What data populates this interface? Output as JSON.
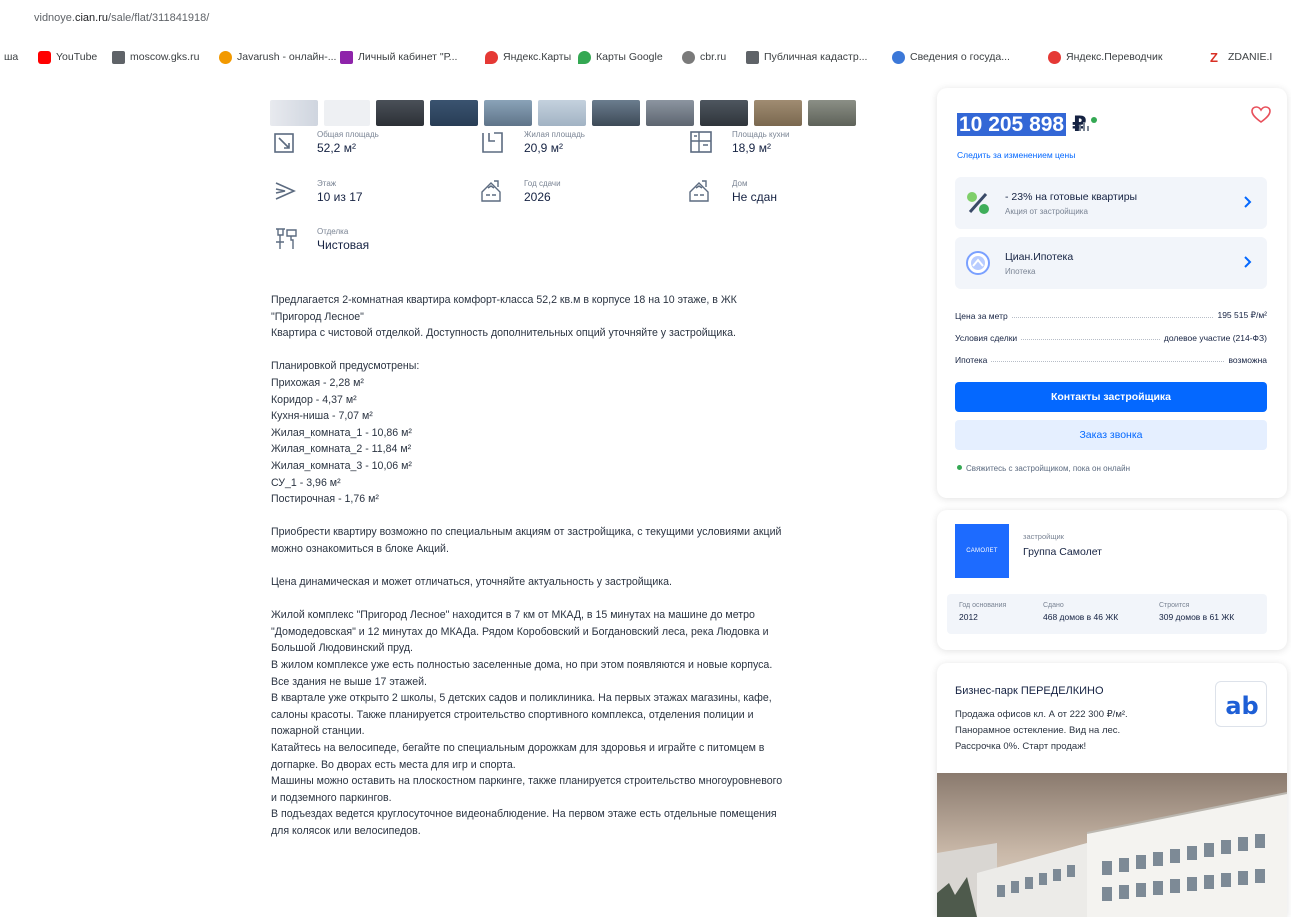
{
  "browser": {
    "url_prefix": "vidnoye.",
    "url_domain": "cian.ru",
    "url_path": "/sale/flat/311841918/",
    "bookmarks": [
      {
        "label": "ша",
        "color": "#ffffff",
        "icon": "none"
      },
      {
        "label": "YouTube",
        "color": "#ff0000",
        "icon": "youtube-icon"
      },
      {
        "label": "moscow.gks.ru",
        "color": "#5f6368",
        "icon": "doc-icon"
      },
      {
        "label": "Javarush - онлайн-...",
        "color": "#f29900",
        "icon": "javarush-icon"
      },
      {
        "label": "Личный кабинет \"Р...",
        "color": "#8e24aa",
        "icon": "person-icon"
      },
      {
        "label": "Яндекс.Карты",
        "color": "#e53935",
        "icon": "pin-icon"
      },
      {
        "label": "Карты Google",
        "color": "#34a853",
        "icon": "pin-icon"
      },
      {
        "label": "cbr.ru",
        "color": "#7a7a7a",
        "icon": "bank-icon"
      },
      {
        "label": "Публичная кадастр...",
        "color": "#5f6368",
        "icon": "doc-icon"
      },
      {
        "label": "Сведения о госуда...",
        "color": "#3c78d8",
        "icon": "globe-icon"
      },
      {
        "label": "Яндекс.Переводчик",
        "color": "#e53935",
        "icon": "translate-icon"
      },
      {
        "label": "ZDANIE.I",
        "color": "#d93025",
        "icon": "z-icon"
      }
    ]
  },
  "features": [
    {
      "label": "Общая площадь",
      "value": "52,2 м²",
      "icon": "area-icon"
    },
    {
      "label": "Жилая площадь",
      "value": "20,9 м²",
      "icon": "living-area-icon"
    },
    {
      "label": "Площадь кухни",
      "value": "18,9 м²",
      "icon": "kitchen-icon"
    },
    {
      "label": "Этаж",
      "value": "10 из 17",
      "icon": "stairs-icon"
    },
    {
      "label": "Год сдачи",
      "value": "2026",
      "icon": "building-icon"
    },
    {
      "label": "Дом",
      "value": "Не сдан",
      "icon": "building-icon"
    },
    {
      "label": "Отделка",
      "value": "Чистовая",
      "icon": "finish-icon"
    }
  ],
  "description": [
    "Предлагается 2-комнатная квартира комфорт-класса 52,2 кв.м в корпусе 18 на 10 этаже, в ЖК",
    "\"Пригород Лесное\"",
    "Квартира с чистовой отделкой. Доступность дополнительных опций уточняйте у застройщика.",
    "",
    "Планировкой предусмотрены:",
    "Прихожая - 2,28 м²",
    "Коридор - 4,37 м²",
    "Кухня-ниша - 7,07 м²",
    "Жилая_комната_1 - 10,86 м²",
    "Жилая_комната_2 - 11,84 м²",
    "Жилая_комната_3 - 10,06 м²",
    "СУ_1 - 3,96 м²",
    "Постирочная - 1,76 м²",
    "",
    "Приобрести квартиру возможно по специальным акциям от застройщика, с текущими условиями акций",
    "можно ознакомиться в блоке Акций.",
    "",
    "Цена динамическая и может отличаться, уточняйте актуальность у застройщика.",
    "",
    "Жилой комплекс \"Пригород Лесное\" находится в 7 км от МКАД, в 15 минутах на машине до метро",
    "\"Домодедовская\" и 12 минутах до МКАДа. Рядом Коробовский и Богдановский леса, река Людовка и",
    "Большой Людовинский пруд.",
    "В жилом комплексе уже есть полностью заселенные дома, но при этом появляются и новые корпуса.",
    "Все здания не выше 17 этажей.",
    "В квартале уже открыто 2 школы, 5 детских садов и поликлиника. На первых этажах магазины, кафе,",
    "салоны красоты. Также планируется строительство спортивного комплекса, отделения полиции и",
    "пожарной станции.",
    "Катайтесь на велосипеде, бегайте по специальным дорожкам для здоровья и играйте с питомцем в",
    "догпарке. Во дворах есть места для игр и спорта.",
    "Машины можно оставить на плоскостном паркинге, также планируется строительство многоуровневого",
    "и подземного паркингов.",
    "В подъездах ведется круглосуточное видеонаблюдение. На первом этаже есть отдельные помещения",
    "для колясок или велосипедов."
  ],
  "price_card": {
    "price": "10 205 898",
    "currency": "₽",
    "track_label": "Следить за изменением цены",
    "promos": [
      {
        "title": "- 23% на готовые квартиры",
        "subtitle": "Акция от застройщика",
        "icon": "percent-icon"
      },
      {
        "title": "Циан.Ипотека",
        "subtitle": "Ипотека",
        "icon": "mortgage-icon"
      }
    ],
    "rows": [
      {
        "label": "Цена за метр",
        "value": "195 515 ₽/м²"
      },
      {
        "label": "Условия сделки",
        "value": "долевое участие (214-ФЗ)"
      },
      {
        "label": "Ипотека",
        "value": "возможна"
      }
    ],
    "contact_button": "Контакты застройщика",
    "callback_button": "Заказ звонка",
    "online_note": "Свяжитесь с застройщиком, пока он онлайн"
  },
  "developer": {
    "logo_text": "САМОЛЕТ",
    "role": "застройщик",
    "name": "Группа Самолет",
    "stats": [
      {
        "label": "Год основания",
        "value": "2012"
      },
      {
        "label": "Сдано",
        "value": "468 домов в 46 ЖК"
      },
      {
        "label": "Строится",
        "value": "309 домов в 61 ЖК"
      }
    ]
  },
  "ad": {
    "title": "Бизнес-парк ПЕРЕДЕЛКИНО",
    "text": "Продажа офисов кл. А от 222 300 ₽/м². Панорамное остекление. Вид на лес. Рассрочка 0%. Старт продаж!",
    "logo": "ab"
  },
  "colors": {
    "accent": "#0468ff",
    "text": "#152242",
    "muted": "#7a8494",
    "heart": "#e8505b"
  }
}
